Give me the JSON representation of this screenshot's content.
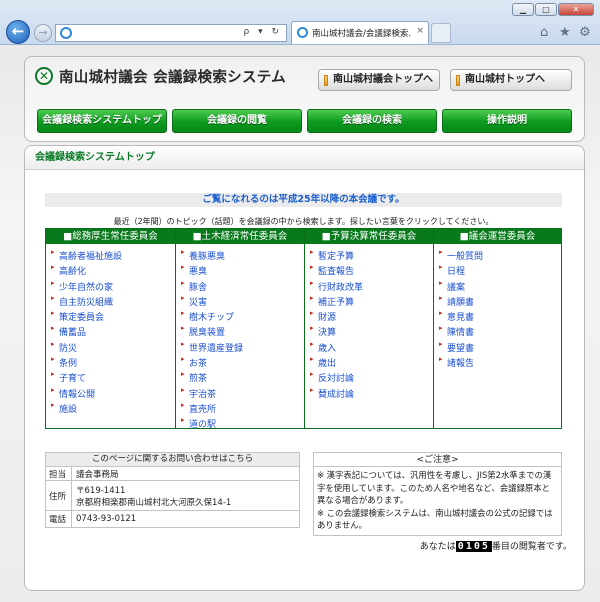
{
  "browser": {
    "tab_title": "南山城村議会/会議録検索...",
    "tab_close": "×",
    "address_tools": "ρ ▾ ↻",
    "window_buttons": {
      "minimize": "▁",
      "maximize": "□",
      "close": "✕"
    },
    "back_glyph": "←",
    "forward_glyph": "→",
    "right_icons": {
      "home": "⌂",
      "favorites": "★",
      "settings": "⚙"
    }
  },
  "header": {
    "logo_glyph": "✕",
    "title": "南山城村議会 会議録検索システム",
    "links": [
      {
        "label": "南山城村議会トップへ"
      },
      {
        "label": "南山城村トップへ"
      }
    ],
    "nav": [
      {
        "label": "会議録検索システムトップ"
      },
      {
        "label": "会議録の閲覧"
      },
      {
        "label": "会議録の検索"
      },
      {
        "label": "操作説明"
      }
    ]
  },
  "main": {
    "heading": "会議録検索システムトップ",
    "notice": "ご覧になれるのは平成25年以降の本会議です。",
    "lead": "最近（2年間）のトピック（話題）を会議録の中から検索します。探したい言葉をクリックしてください。",
    "committees": [
      {
        "name": "■総務厚生常任委員会",
        "topics": [
          "高齢者福祉施設",
          "高齢化",
          "少年自然の家",
          "自主防災組織",
          "策定委員会",
          "備蓄品",
          "防災",
          "条例",
          "子育て",
          "情報公開",
          "施設"
        ]
      },
      {
        "name": "■土木経済常任委員会",
        "topics": [
          "養豚悪臭",
          "悪臭",
          "豚舎",
          "災害",
          "樹木チップ",
          "脱臭装置",
          "世界遺産登録",
          "お茶",
          "煎茶",
          "宇治茶",
          "直売所",
          "道の駅"
        ]
      },
      {
        "name": "■予算決算常任委員会",
        "topics": [
          "暫定予算",
          "監査報告",
          "行財政改革",
          "補正予算",
          "財源",
          "決算",
          "歳入",
          "歳出",
          "反対討論",
          "賛成討論"
        ]
      },
      {
        "name": "■議会運営委員会",
        "topics": [
          "一般質問",
          "日程",
          "議案",
          "請願書",
          "意見書",
          "陳情書",
          "要望書",
          "諸報告"
        ]
      }
    ],
    "contact": {
      "title": "このページに関するお問い合わせはこちら",
      "rows": [
        {
          "key": "担当",
          "lines": [
            "議会事務局"
          ]
        },
        {
          "key": "住所",
          "lines": [
            "〒619-1411",
            "京都府相楽郡南山城村北大河原久保14-1"
          ]
        },
        {
          "key": "電話",
          "lines": [
            "0743-93-0121"
          ]
        }
      ]
    },
    "caution": {
      "title": "<ご注意>",
      "paragraphs": [
        "※ 漢字表記については、汎用性を考慮し、JIS第2水準までの漢字を使用しています。このため人名や地名など、会議録原本と異なる場合があります。",
        "※ この会議録検索システムは、南山城村議会の公式の記録ではありません。"
      ]
    },
    "counter": {
      "prefix": "あなたは",
      "digits": "0105",
      "suffix": "番目の閲覧者です。"
    }
  }
}
